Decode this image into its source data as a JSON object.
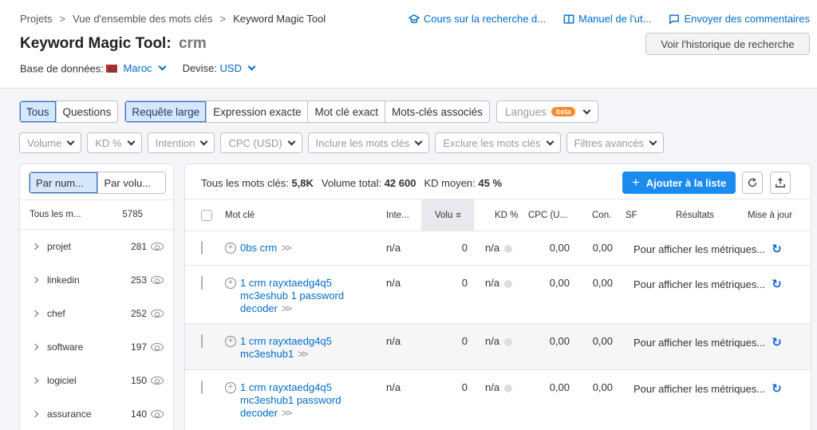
{
  "breadcrumb": {
    "items": [
      "Projets",
      "Vue d'ensemble des mots clés",
      "Keyword Magic Tool"
    ]
  },
  "toplinks": {
    "course": "Cours sur la recherche d...",
    "manual": "Manuel de l'ut...",
    "feedback": "Envoyer des commentaires"
  },
  "header": {
    "title": "Keyword Magic Tool:",
    "query": "crm",
    "history_button": "Voir l'historique de recherche"
  },
  "meta": {
    "db_label": "Base de données:",
    "db_value": "Maroc",
    "currency_label": "Devise:",
    "currency_value": "USD"
  },
  "filters": {
    "type_tabs": [
      "Tous",
      "Questions"
    ],
    "match_tabs": [
      "Requête large",
      "Expression exacte",
      "Mot clé exact",
      "Mots-clés associés"
    ],
    "languages": "Langues",
    "beta": "beta",
    "dropdowns": [
      "Volume",
      "KD %",
      "Intention",
      "CPC (USD)",
      "Inclure les mots clés",
      "Exclure les mots clés",
      "Filtres avancés"
    ]
  },
  "sidebar": {
    "tabs": [
      "Par num...",
      "Par volu..."
    ],
    "all_label": "Tous les m...",
    "all_count": "5785",
    "items": [
      {
        "label": "projet",
        "count": "281"
      },
      {
        "label": "linkedin",
        "count": "253"
      },
      {
        "label": "chef",
        "count": "252"
      },
      {
        "label": "software",
        "count": "197"
      },
      {
        "label": "logiciel",
        "count": "150"
      },
      {
        "label": "assurance",
        "count": "140"
      }
    ]
  },
  "summary": {
    "all_label": "Tous les mots clés:",
    "all_value": "5,8K",
    "volume_label": "Volume total:",
    "volume_value": "42 600",
    "kd_label": "KD moyen:",
    "kd_value": "45 %",
    "add_button": "Ajouter à la liste"
  },
  "table": {
    "headers": {
      "keyword": "Mot clé",
      "intent": "Inte...",
      "volume": "Volu",
      "kd": "KD %",
      "cpc": "CPC (U...",
      "com": "Con.",
      "sf": "SF",
      "results": "Résultats",
      "update": "Mise à jour"
    },
    "rows": [
      {
        "keyword": "0bs crm",
        "intent": "n/a",
        "volume": "0",
        "kd": "n/a",
        "cpc": "0,00",
        "com": "0,00",
        "results": "Pour afficher les métriques..."
      },
      {
        "keyword": "1 crm rayxtaedg4q5 mc3eshub 1 password decoder",
        "intent": "n/a",
        "volume": "0",
        "kd": "n/a",
        "cpc": "0,00",
        "com": "0,00",
        "results": "Pour afficher les métriques..."
      },
      {
        "keyword": "1 crm rayxtaedg4q5 mc3eshub1",
        "intent": "n/a",
        "volume": "0",
        "kd": "n/a",
        "cpc": "0,00",
        "com": "0,00",
        "results": "Pour afficher les métriques..."
      },
      {
        "keyword": "1 crm rayxtaedg4q5 mc3eshub1 password decoder",
        "intent": "n/a",
        "volume": "0",
        "kd": "n/a",
        "cpc": "0,00",
        "com": "0,00",
        "results": "Pour afficher les métriques..."
      }
    ]
  },
  "colors": {
    "accent": "#006dca",
    "primary_button": "#1b8bf0",
    "beta": "#ff8c2c"
  }
}
